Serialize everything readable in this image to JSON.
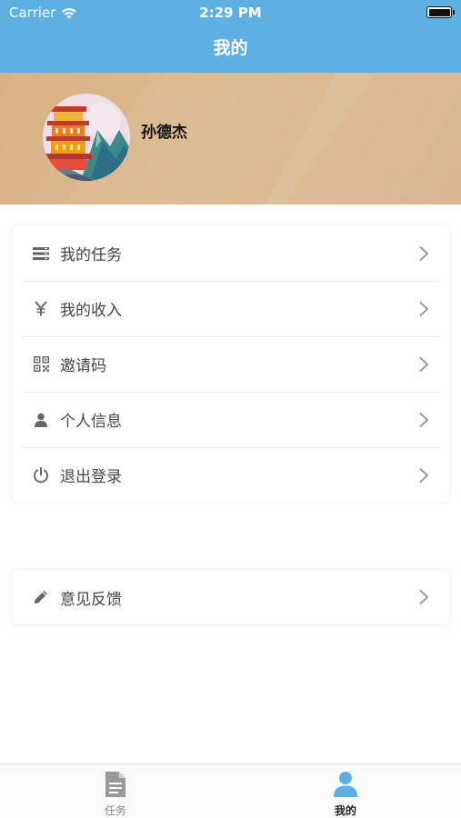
{
  "status_bar": {
    "carrier": "Carrier",
    "time": "2:29 PM"
  },
  "nav": {
    "title": "我的"
  },
  "profile": {
    "username": "孙德杰"
  },
  "menu": {
    "items": [
      {
        "label": "我的任务",
        "icon": "task-list-icon"
      },
      {
        "label": "我的收入",
        "icon": "yen-icon"
      },
      {
        "label": "邀请码",
        "icon": "qr-code-icon"
      },
      {
        "label": "个人信息",
        "icon": "user-icon"
      },
      {
        "label": "退出登录",
        "icon": "power-icon"
      }
    ],
    "feedback": {
      "label": "意见反馈",
      "icon": "pencil-icon"
    }
  },
  "tabbar": {
    "tabs": [
      {
        "label": "任务",
        "icon": "document-icon",
        "active": false
      },
      {
        "label": "我的",
        "icon": "person-icon",
        "active": true
      }
    ]
  },
  "colors": {
    "nav_bar": "#5eb0e4",
    "header_bg": "#d9b184",
    "tab_active": "#5eb0e4",
    "tab_inactive": "#999999"
  }
}
